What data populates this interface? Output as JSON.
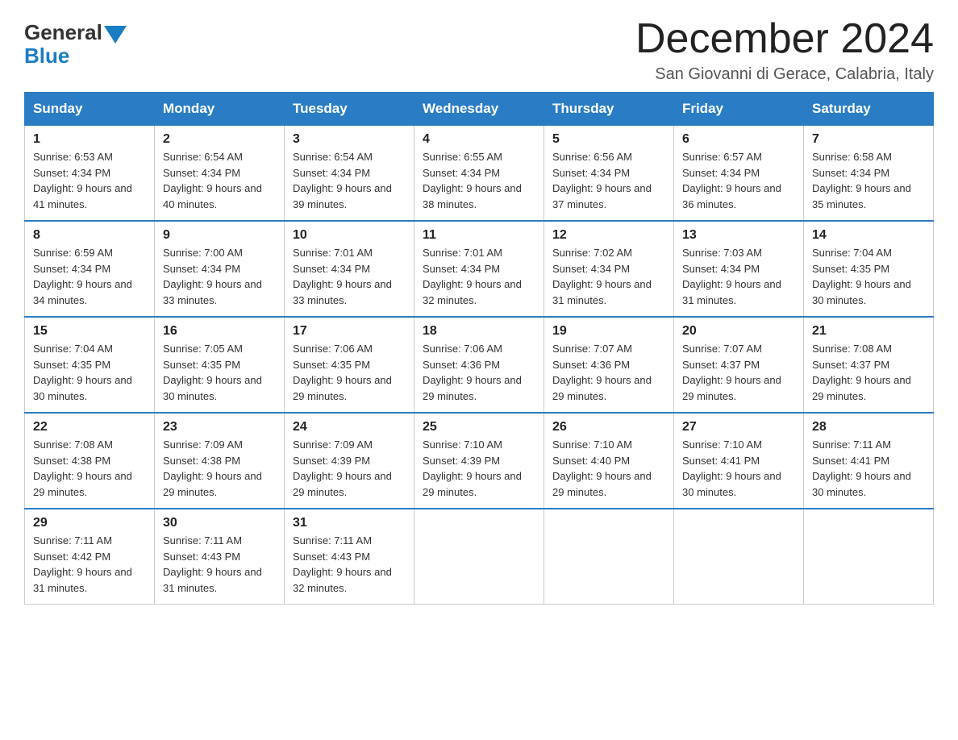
{
  "logo": {
    "general": "General",
    "blue": "Blue"
  },
  "title": "December 2024",
  "location": "San Giovanni di Gerace, Calabria, Italy",
  "days_of_week": [
    "Sunday",
    "Monday",
    "Tuesday",
    "Wednesday",
    "Thursday",
    "Friday",
    "Saturday"
  ],
  "weeks": [
    [
      {
        "day": "1",
        "sunrise": "6:53 AM",
        "sunset": "4:34 PM",
        "daylight": "9 hours and 41 minutes."
      },
      {
        "day": "2",
        "sunrise": "6:54 AM",
        "sunset": "4:34 PM",
        "daylight": "9 hours and 40 minutes."
      },
      {
        "day": "3",
        "sunrise": "6:54 AM",
        "sunset": "4:34 PM",
        "daylight": "9 hours and 39 minutes."
      },
      {
        "day": "4",
        "sunrise": "6:55 AM",
        "sunset": "4:34 PM",
        "daylight": "9 hours and 38 minutes."
      },
      {
        "day": "5",
        "sunrise": "6:56 AM",
        "sunset": "4:34 PM",
        "daylight": "9 hours and 37 minutes."
      },
      {
        "day": "6",
        "sunrise": "6:57 AM",
        "sunset": "4:34 PM",
        "daylight": "9 hours and 36 minutes."
      },
      {
        "day": "7",
        "sunrise": "6:58 AM",
        "sunset": "4:34 PM",
        "daylight": "9 hours and 35 minutes."
      }
    ],
    [
      {
        "day": "8",
        "sunrise": "6:59 AM",
        "sunset": "4:34 PM",
        "daylight": "9 hours and 34 minutes."
      },
      {
        "day": "9",
        "sunrise": "7:00 AM",
        "sunset": "4:34 PM",
        "daylight": "9 hours and 33 minutes."
      },
      {
        "day": "10",
        "sunrise": "7:01 AM",
        "sunset": "4:34 PM",
        "daylight": "9 hours and 33 minutes."
      },
      {
        "day": "11",
        "sunrise": "7:01 AM",
        "sunset": "4:34 PM",
        "daylight": "9 hours and 32 minutes."
      },
      {
        "day": "12",
        "sunrise": "7:02 AM",
        "sunset": "4:34 PM",
        "daylight": "9 hours and 31 minutes."
      },
      {
        "day": "13",
        "sunrise": "7:03 AM",
        "sunset": "4:34 PM",
        "daylight": "9 hours and 31 minutes."
      },
      {
        "day": "14",
        "sunrise": "7:04 AM",
        "sunset": "4:35 PM",
        "daylight": "9 hours and 30 minutes."
      }
    ],
    [
      {
        "day": "15",
        "sunrise": "7:04 AM",
        "sunset": "4:35 PM",
        "daylight": "9 hours and 30 minutes."
      },
      {
        "day": "16",
        "sunrise": "7:05 AM",
        "sunset": "4:35 PM",
        "daylight": "9 hours and 30 minutes."
      },
      {
        "day": "17",
        "sunrise": "7:06 AM",
        "sunset": "4:35 PM",
        "daylight": "9 hours and 29 minutes."
      },
      {
        "day": "18",
        "sunrise": "7:06 AM",
        "sunset": "4:36 PM",
        "daylight": "9 hours and 29 minutes."
      },
      {
        "day": "19",
        "sunrise": "7:07 AM",
        "sunset": "4:36 PM",
        "daylight": "9 hours and 29 minutes."
      },
      {
        "day": "20",
        "sunrise": "7:07 AM",
        "sunset": "4:37 PM",
        "daylight": "9 hours and 29 minutes."
      },
      {
        "day": "21",
        "sunrise": "7:08 AM",
        "sunset": "4:37 PM",
        "daylight": "9 hours and 29 minutes."
      }
    ],
    [
      {
        "day": "22",
        "sunrise": "7:08 AM",
        "sunset": "4:38 PM",
        "daylight": "9 hours and 29 minutes."
      },
      {
        "day": "23",
        "sunrise": "7:09 AM",
        "sunset": "4:38 PM",
        "daylight": "9 hours and 29 minutes."
      },
      {
        "day": "24",
        "sunrise": "7:09 AM",
        "sunset": "4:39 PM",
        "daylight": "9 hours and 29 minutes."
      },
      {
        "day": "25",
        "sunrise": "7:10 AM",
        "sunset": "4:39 PM",
        "daylight": "9 hours and 29 minutes."
      },
      {
        "day": "26",
        "sunrise": "7:10 AM",
        "sunset": "4:40 PM",
        "daylight": "9 hours and 29 minutes."
      },
      {
        "day": "27",
        "sunrise": "7:10 AM",
        "sunset": "4:41 PM",
        "daylight": "9 hours and 30 minutes."
      },
      {
        "day": "28",
        "sunrise": "7:11 AM",
        "sunset": "4:41 PM",
        "daylight": "9 hours and 30 minutes."
      }
    ],
    [
      {
        "day": "29",
        "sunrise": "7:11 AM",
        "sunset": "4:42 PM",
        "daylight": "9 hours and 31 minutes."
      },
      {
        "day": "30",
        "sunrise": "7:11 AM",
        "sunset": "4:43 PM",
        "daylight": "9 hours and 31 minutes."
      },
      {
        "day": "31",
        "sunrise": "7:11 AM",
        "sunset": "4:43 PM",
        "daylight": "9 hours and 32 minutes."
      },
      null,
      null,
      null,
      null
    ]
  ]
}
